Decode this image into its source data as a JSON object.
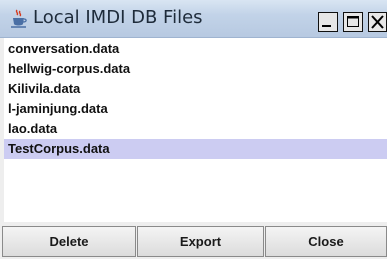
{
  "window": {
    "title": "Local IMDI DB Files",
    "app_icon": "java-cup-icon"
  },
  "files": [
    {
      "name": "conversation.data",
      "selected": false
    },
    {
      "name": "hellwig-corpus.data",
      "selected": false
    },
    {
      "name": "Kilivila.data",
      "selected": false
    },
    {
      "name": "l-jaminjung.data",
      "selected": false
    },
    {
      "name": "lao.data",
      "selected": false
    },
    {
      "name": "TestCorpus.data",
      "selected": true
    }
  ],
  "buttons": {
    "delete_label": "Delete",
    "export_label": "Export",
    "close_label": "Close"
  },
  "colors": {
    "selection": "#ccccf2",
    "titlebar": "#c2d3e8"
  }
}
